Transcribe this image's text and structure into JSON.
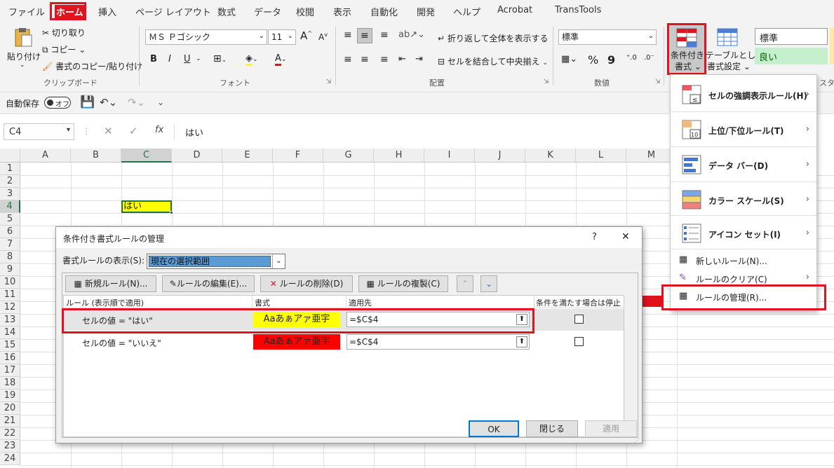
{
  "tabs": [
    "ファイル",
    "ホーム",
    "挿入",
    "ページ レイアウト",
    "数式",
    "データ",
    "校閲",
    "表示",
    "自動化",
    "開発",
    "ヘルプ",
    "Acrobat",
    "TransTools"
  ],
  "clipboard": {
    "paste": "貼り付け",
    "cut": "切り取り",
    "copy": "コピー",
    "format_painter": "書式のコピー/貼り付け",
    "group": "クリップボード"
  },
  "font": {
    "name": "ＭＳ Ｐゴシック",
    "size": "11",
    "bold": "B",
    "italic": "I",
    "underline": "U",
    "group": "フォント",
    "grow": "A",
    "shrink": "A",
    "fontcolor": "A"
  },
  "alignment": {
    "wrap": "折り返して全体を表示する",
    "merge": "セルを結合して中央揃え",
    "group": "配置"
  },
  "number": {
    "format": "標準",
    "percent": "%",
    "comma": "9",
    "group": "数値"
  },
  "styles": {
    "cond_format_l1": "条件付き",
    "cond_format_l2": "書式",
    "table_l1": "テーブルとして",
    "table_l2": "書式設定",
    "style_normal": "標準",
    "style_good": "良い",
    "group_partial": "スタイ"
  },
  "qat": {
    "autosave": "自動保存",
    "toggle": "オフ"
  },
  "formula": {
    "namebox": "C4",
    "fx": "fx",
    "value": "はい"
  },
  "columns": [
    "A",
    "B",
    "C",
    "D",
    "E",
    "F",
    "G",
    "H",
    "I",
    "J",
    "K",
    "L",
    "M"
  ],
  "rows": [
    "1",
    "2",
    "3",
    "4",
    "5",
    "6",
    "7",
    "8",
    "9",
    "10",
    "11",
    "12",
    "13",
    "14",
    "15",
    "16",
    "17",
    "18",
    "19",
    "20",
    "21",
    "22",
    "23",
    "24"
  ],
  "cell_c4": "はい",
  "cf_menu": {
    "items": [
      {
        "label": "セルの強調表示ルール(H)"
      },
      {
        "label": "上位/下位ルール(T)"
      },
      {
        "label": "データ バー(D)"
      },
      {
        "label": "カラー スケール(S)"
      },
      {
        "label": "アイコン セット(I)"
      }
    ],
    "new_rule": "新しいルール(N)...",
    "clear_rules": "ルールのクリア(C)",
    "manage_rules": "ルールの管理(R)..."
  },
  "dialog": {
    "title": "条件付き書式ルールの管理",
    "help": "?",
    "close": "✕",
    "show_label": "書式ルールの表示(S):",
    "show_value": "現在の選択範囲",
    "btn_new": "新規ルール(N)...",
    "btn_edit": "ルールの編集(E)...",
    "btn_delete": "ルールの削除(D)",
    "btn_dup": "ルールの複製(C)",
    "col_rule": "ルール (表示順で適用)",
    "col_format": "書式",
    "col_applies": "適用先",
    "col_stop": "条件を満たす場合は停止",
    "rules": [
      {
        "rule": "セルの値 = \"はい\"",
        "format": "Aaあぁアァ亜宇",
        "format_bg": "#ffff00",
        "applies": "=$C$4"
      },
      {
        "rule": "セルの値 = \"いいえ\"",
        "format": "Aaあぁアァ亜宇",
        "format_bg": "#ff0000",
        "applies": "=$C$4"
      }
    ],
    "ok": "OK",
    "close_btn": "閉じる",
    "apply": "適用"
  },
  "colors": {
    "accent_red": "#e0141e",
    "yes_fill": "#ffff00",
    "no_fill": "#ff0000",
    "good_fill": "#c6efce",
    "excel_green": "#217346"
  }
}
